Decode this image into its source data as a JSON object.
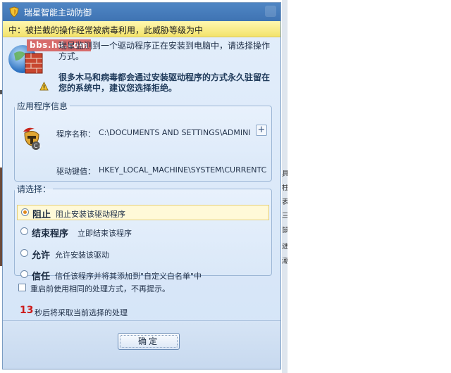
{
  "background": {
    "side_chars": [
      "具",
      "柱",
      "表",
      "三",
      "鼠",
      "迷",
      "潮"
    ]
  },
  "dialog": {
    "title": "瑞星智能主动防御",
    "warning_bar": "中：被拦截的操作经常被病毒利用，此威胁等级为中",
    "forum_label": "bbs.hd.com",
    "intro": "瑞星监测到一个驱动程序正在安装到电脑中，请选择操作方式。",
    "bold_note": "很多木马和病毒都会通过安装驱动程序的方式永久驻留在您的系统中，建议您选择拒绝。",
    "app_info": {
      "legend": "应用程序信息",
      "program_label": "程序名称：",
      "program_value": "C:\\DOCUMENTS AND SETTINGS\\ADMINISTR...",
      "expand_symbol": "+",
      "driver_label": "驱动键值：",
      "driver_value": "HKEY_LOCAL_MACHINE\\SYSTEM\\CURRENTC"
    },
    "choices": {
      "legend": "请选择：",
      "options": [
        {
          "title": "阻止",
          "desc": "阻止安装该驱动程序",
          "selected": true
        },
        {
          "title": "结束程序",
          "desc": "立即结束该程序",
          "selected": false
        },
        {
          "title": "允许",
          "desc": "允许安装该驱动",
          "selected": false
        },
        {
          "title": "信任",
          "desc": "信任该程序并将其添加到\"自定义白名单\"中",
          "selected": false
        }
      ]
    },
    "remember_checkbox": {
      "label": "重启前使用相同的处理方式，不再提示。",
      "checked": false
    },
    "countdown": {
      "seconds": "13",
      "text": "秒后将采取当前选择的处理"
    },
    "ok_button": "确定"
  },
  "colors": {
    "accent": "#3f73b3",
    "warning_bg": "#f3e36b",
    "countdown": "#cc1b1b",
    "selected_bg": "#fff9d8"
  },
  "icons": {
    "title": "shield-icon",
    "main": "firewall-shield-icon",
    "alert": "warning-icon",
    "app": "helmet-program-icon"
  }
}
